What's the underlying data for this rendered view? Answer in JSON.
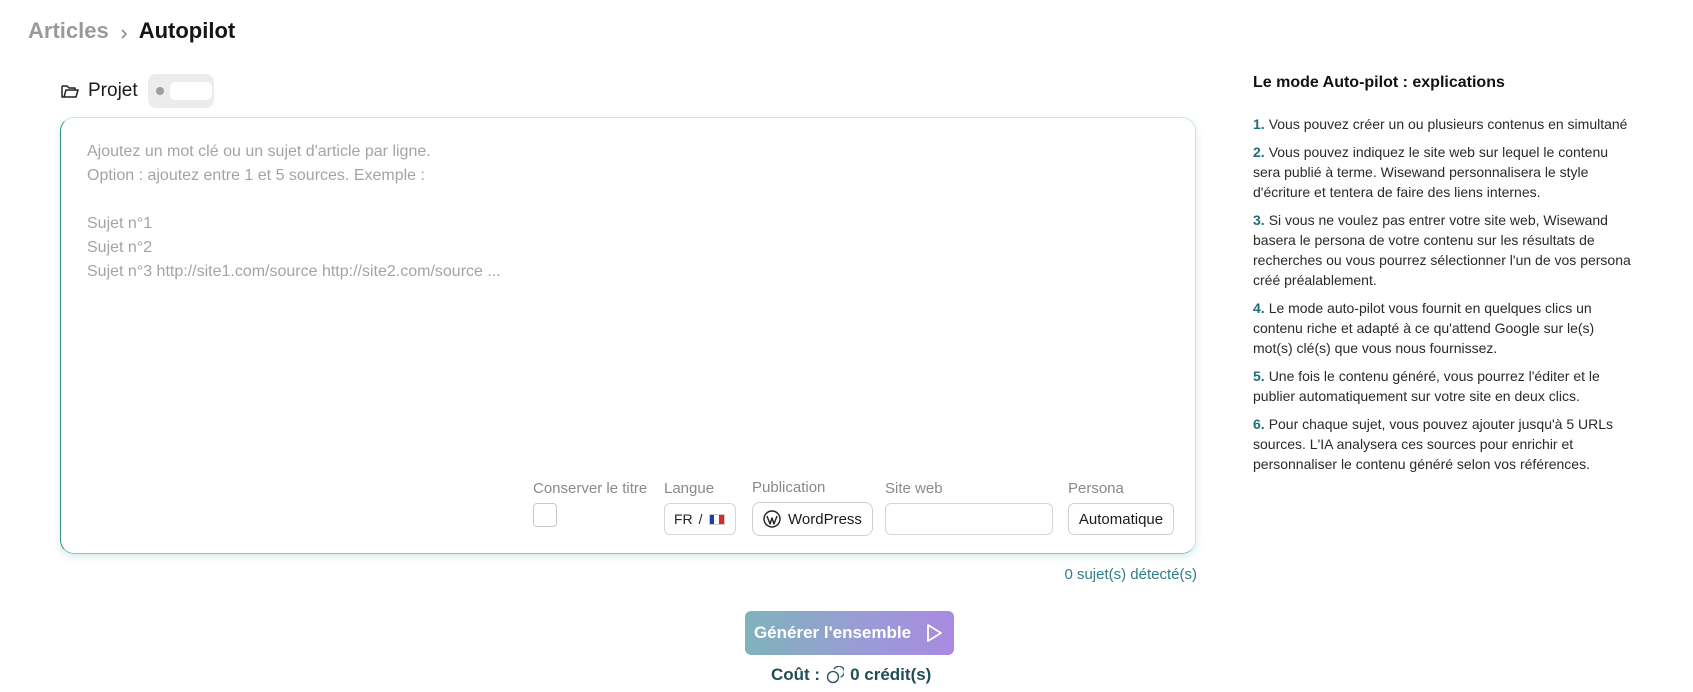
{
  "breadcrumb": {
    "parent": "Articles",
    "current": "Autopilot"
  },
  "project": {
    "label": "Projet"
  },
  "editor": {
    "placeholder": "Ajoutez un mot clé ou un sujet d'article par ligne.\nOption : ajoutez entre 1 et 5 sources. Exemple :\n\nSujet n°1\nSujet n°2\nSujet n°3 http://site1.com/source http://site2.com/source ...",
    "value": ""
  },
  "options": {
    "keep_title_label": "Conserver le titre",
    "language_label": "Langue",
    "language_value": "FR",
    "language_sep": "/",
    "publication_label": "Publication",
    "publication_value": "WordPress",
    "website_label": "Site web",
    "website_value": "",
    "persona_label": "Persona",
    "persona_value": "Automatique"
  },
  "detected": "0 sujet(s) détecté(s)",
  "generate_label": "Générer l'ensemble",
  "cost": {
    "label": "Coût :",
    "value": "0 crédit(s)"
  },
  "help": {
    "title": "Le mode Auto-pilot : explications",
    "items": [
      {
        "num": "1.",
        "text": "Vous pouvez créer un ou plusieurs contenus en simultané"
      },
      {
        "num": "2.",
        "text": "Vous pouvez indiquez le site web sur lequel le contenu sera publié à terme. Wisewand personnalisera le style d'écriture et tentera de faire des liens internes."
      },
      {
        "num": "3.",
        "text": "Si vous ne voulez pas entrer votre site web, Wisewand basera le persona de votre contenu sur les résultats de recherches ou vous pourrez sélectionner l'un de vos persona créé préalablement."
      },
      {
        "num": "4.",
        "text": "Le mode auto-pilot vous fournit en quelques clics un contenu riche et adapté à ce qu'attend Google sur le(s) mot(s) clé(s) que vous nous fournissez."
      },
      {
        "num": "5.",
        "text": "Une fois le contenu généré, vous pourrez l'éditer et le publier automatiquement sur votre site en deux clics."
      },
      {
        "num": "6.",
        "text": "Pour chaque sujet, vous pouvez ajouter jusqu'à 5 URLs sources. L'IA analysera ces sources pour enrichir et personnaliser le contenu généré selon vos références."
      }
    ]
  },
  "colors": {
    "accent": "#2f7f86",
    "gradient_start": "#7fb3bb",
    "gradient_end": "#a98ae0"
  }
}
